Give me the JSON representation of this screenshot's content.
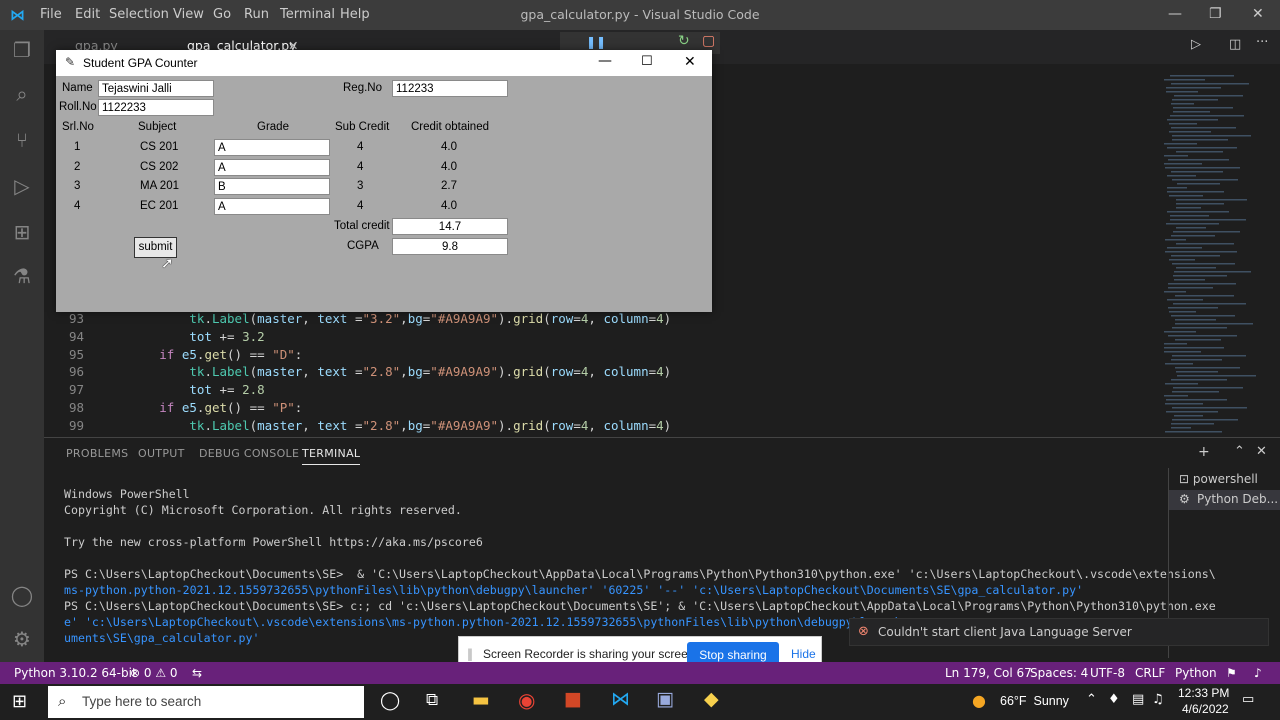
{
  "vscode": {
    "menu": [
      "File",
      "Edit",
      "Selection",
      "View",
      "Go",
      "Run",
      "Terminal",
      "Help"
    ],
    "window_title": "gpa_calculator.py - Visual Studio Code",
    "tabs": [
      {
        "label": "gpa.py"
      },
      {
        "label": "gpa_calculator.py"
      }
    ],
    "code_lines": [
      {
        "num": "93",
        "indent": "        ",
        "parts": [
          [
            "cls",
            "tk"
          ],
          [
            "plain",
            "."
          ],
          [
            "cls",
            "Label"
          ],
          [
            "plain",
            "("
          ],
          [
            "var",
            "master"
          ],
          [
            "plain",
            ", "
          ],
          [
            "var",
            "text"
          ],
          [
            "plain",
            " ="
          ],
          [
            "str",
            "\"3.2\""
          ],
          [
            "plain",
            ","
          ],
          [
            "var",
            "bg"
          ],
          [
            "plain",
            "="
          ],
          [
            "str",
            "\"#A9A9A9\""
          ],
          [
            "plain",
            ")."
          ],
          [
            "fn",
            "grid"
          ],
          [
            "plain",
            "("
          ],
          [
            "var",
            "row"
          ],
          [
            "plain",
            "="
          ],
          [
            "num",
            "4"
          ],
          [
            "plain",
            ", "
          ],
          [
            "var",
            "column"
          ],
          [
            "plain",
            "="
          ],
          [
            "num",
            "4"
          ],
          [
            "plain",
            ")"
          ]
        ]
      },
      {
        "num": "94",
        "indent": "        ",
        "parts": [
          [
            "var",
            "tot"
          ],
          [
            "plain",
            " += "
          ],
          [
            "num",
            "3.2"
          ]
        ]
      },
      {
        "num": "95",
        "indent": "    ",
        "parts": [
          [
            "kw",
            "if"
          ],
          [
            "plain",
            " "
          ],
          [
            "var",
            "e5"
          ],
          [
            "plain",
            "."
          ],
          [
            "fn",
            "get"
          ],
          [
            "plain",
            "() == "
          ],
          [
            "str",
            "\"D\""
          ],
          [
            "plain",
            ":"
          ]
        ]
      },
      {
        "num": "96",
        "indent": "        ",
        "parts": [
          [
            "cls",
            "tk"
          ],
          [
            "plain",
            "."
          ],
          [
            "cls",
            "Label"
          ],
          [
            "plain",
            "("
          ],
          [
            "var",
            "master"
          ],
          [
            "plain",
            ", "
          ],
          [
            "var",
            "text"
          ],
          [
            "plain",
            " ="
          ],
          [
            "str",
            "\"2.8\""
          ],
          [
            "plain",
            ","
          ],
          [
            "var",
            "bg"
          ],
          [
            "plain",
            "="
          ],
          [
            "str",
            "\"#A9A9A9\""
          ],
          [
            "plain",
            ")."
          ],
          [
            "fn",
            "grid"
          ],
          [
            "plain",
            "("
          ],
          [
            "var",
            "row"
          ],
          [
            "plain",
            "="
          ],
          [
            "num",
            "4"
          ],
          [
            "plain",
            ", "
          ],
          [
            "var",
            "column"
          ],
          [
            "plain",
            "="
          ],
          [
            "num",
            "4"
          ],
          [
            "plain",
            ")"
          ]
        ]
      },
      {
        "num": "97",
        "indent": "        ",
        "parts": [
          [
            "var",
            "tot"
          ],
          [
            "plain",
            " += "
          ],
          [
            "num",
            "2.8"
          ]
        ]
      },
      {
        "num": "98",
        "indent": "    ",
        "parts": [
          [
            "kw",
            "if"
          ],
          [
            "plain",
            " "
          ],
          [
            "var",
            "e5"
          ],
          [
            "plain",
            "."
          ],
          [
            "fn",
            "get"
          ],
          [
            "plain",
            "() == "
          ],
          [
            "str",
            "\"P\""
          ],
          [
            "plain",
            ":"
          ]
        ]
      },
      {
        "num": "99",
        "indent": "        ",
        "parts": [
          [
            "cls",
            "tk"
          ],
          [
            "plain",
            "."
          ],
          [
            "cls",
            "Label"
          ],
          [
            "plain",
            "("
          ],
          [
            "var",
            "master"
          ],
          [
            "plain",
            ", "
          ],
          [
            "var",
            "text"
          ],
          [
            "plain",
            " ="
          ],
          [
            "str",
            "\"2.8\""
          ],
          [
            "plain",
            ","
          ],
          [
            "var",
            "bg"
          ],
          [
            "plain",
            "="
          ],
          [
            "str",
            "\"#A9A9A9\""
          ],
          [
            "plain",
            ")."
          ],
          [
            "fn",
            "grid"
          ],
          [
            "plain",
            "("
          ],
          [
            "var",
            "row"
          ],
          [
            "plain",
            "="
          ],
          [
            "num",
            "4"
          ],
          [
            "plain",
            ", "
          ],
          [
            "var",
            "column"
          ],
          [
            "plain",
            "="
          ],
          [
            "num",
            "4"
          ],
          [
            "plain",
            ")"
          ]
        ]
      }
    ],
    "panel_tabs": [
      "PROBLEMS",
      "OUTPUT",
      "DEBUG CONSOLE",
      "TERMINAL"
    ],
    "terminal_lines": [
      "Windows PowerShell",
      "Copyright (C) Microsoft Corporation. All rights reserved.",
      "",
      "Try the new cross-platform PowerShell https://aka.ms/pscore6",
      "",
      "PS C:\\Users\\LaptopCheckout\\Documents\\SE>  & 'C:\\Users\\LaptopCheckout\\AppData\\Local\\Programs\\Python\\Python310\\python.exe' 'c:\\Users\\LaptopCheckout\\.vscode\\extensions\\",
      "ms-python.python-2021.12.1559732655\\pythonFiles\\lib\\python\\debugpy\\launcher' '60225' '--' 'c:\\Users\\LaptopCheckout\\Documents\\SE\\gpa_calculator.py'",
      "PS C:\\Users\\LaptopCheckout\\Documents\\SE> c:; cd 'c:\\Users\\LaptopCheckout\\Documents\\SE'; & 'C:\\Users\\LaptopCheckout\\AppData\\Local\\Programs\\Python\\Python310\\python.exe",
      "e' 'c:\\Users\\LaptopCheckout\\.vscode\\extensions\\ms-python.python-2021.12.1559732655\\pythonFiles\\lib\\python\\debugpy\\launch",
      "uments\\SE\\gpa_calculator.py'"
    ],
    "terminal_list": [
      "powershell",
      "Python Deb..."
    ],
    "notification": "Couldn't start client Java Language Server",
    "status": {
      "python": "Python 3.10.2 64-bit",
      "problems": "⊗ 0 ⚠ 0",
      "position": "Ln 179, Col 67",
      "spaces": "Spaces: 4",
      "encoding": "UTF-8",
      "eol": "CRLF",
      "language": "Python"
    }
  },
  "share_bar": {
    "text": "Screen Recorder is sharing your screen.",
    "stop": "Stop sharing",
    "hide": "Hide"
  },
  "taskbar": {
    "search_placeholder": "Type here to search",
    "weather": "66°F  Sunny",
    "time": "12:33 PM",
    "date": "4/6/2022"
  },
  "tk_app": {
    "title": "Student GPA Counter",
    "name_label": "Name",
    "name_value": "Tejaswini Jalli",
    "regno_label": "Reg.No",
    "regno_value": "112233",
    "rollno_label": "Roll.No",
    "rollno_value": "1122233",
    "headers": [
      "Srl.No",
      "Subject",
      "Grade",
      "Sub Credit",
      "Credit obtained"
    ],
    "rows": [
      {
        "srl": "1",
        "subject": "CS 201",
        "grade": "A",
        "credit": "4",
        "obtained": "4.0"
      },
      {
        "srl": "2",
        "subject": "CS 202",
        "grade": "A",
        "credit": "4",
        "obtained": "4.0"
      },
      {
        "srl": "3",
        "subject": "MA 201",
        "grade": "B",
        "credit": "3",
        "obtained": "2.7"
      },
      {
        "srl": "4",
        "subject": "EC 201",
        "grade": "A",
        "credit": "4",
        "obtained": "4.0"
      }
    ],
    "total_label": "Total credit",
    "total_value": "14.7",
    "cgpa_label": "CGPA",
    "cgpa_value": "9.8",
    "submit_label": "submit"
  }
}
